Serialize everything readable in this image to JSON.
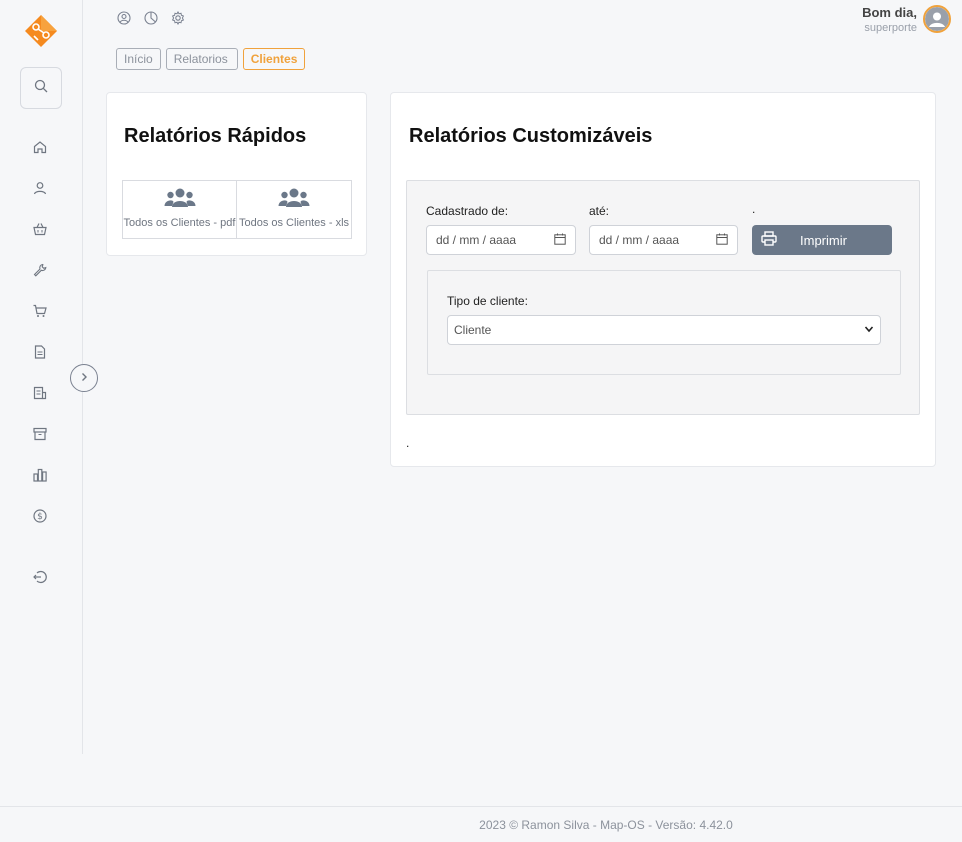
{
  "header": {
    "greeting": "Bom dia,",
    "username": "superporte",
    "top_icons": [
      "user-circle-icon",
      "pie-chart-icon",
      "gear-icon"
    ]
  },
  "sidebar": {
    "items": [
      {
        "icon": "home-icon"
      },
      {
        "icon": "user-icon"
      },
      {
        "icon": "basket-icon"
      },
      {
        "icon": "wrench-icon"
      },
      {
        "icon": "cart-icon"
      },
      {
        "icon": "document-icon"
      },
      {
        "icon": "receipt-icon"
      },
      {
        "icon": "archive-icon"
      },
      {
        "icon": "bar-chart-icon"
      },
      {
        "icon": "dollar-icon"
      },
      {
        "icon": "logout-icon"
      }
    ]
  },
  "breadcrumb": {
    "items": [
      "Início",
      "Relatorios",
      "Clientes"
    ],
    "active": "Clientes"
  },
  "quick_reports": {
    "title": "Relatórios Rápidos",
    "items": [
      {
        "label": "Todos os Clientes - pdf",
        "icon": "users-icon"
      },
      {
        "label": "Todos os Clientes - xls",
        "icon": "users-icon"
      }
    ]
  },
  "custom_reports": {
    "title": "Relatórios Customizáveis",
    "from_label": "Cadastrado de:",
    "to_label": "até:",
    "date_placeholder": "dd / mm / aaaa",
    "dot": ".",
    "print_label": "Imprimir",
    "client_type_label": "Tipo de cliente:",
    "client_type_value": "Cliente",
    "bottom_dot": "."
  },
  "footer": {
    "text": "2023 © Ramon Silva - Map-OS - Versão: 4.42.0"
  },
  "colors": {
    "accent": "#f0a23c",
    "button": "#6b7889",
    "icon": "#6f7681"
  }
}
